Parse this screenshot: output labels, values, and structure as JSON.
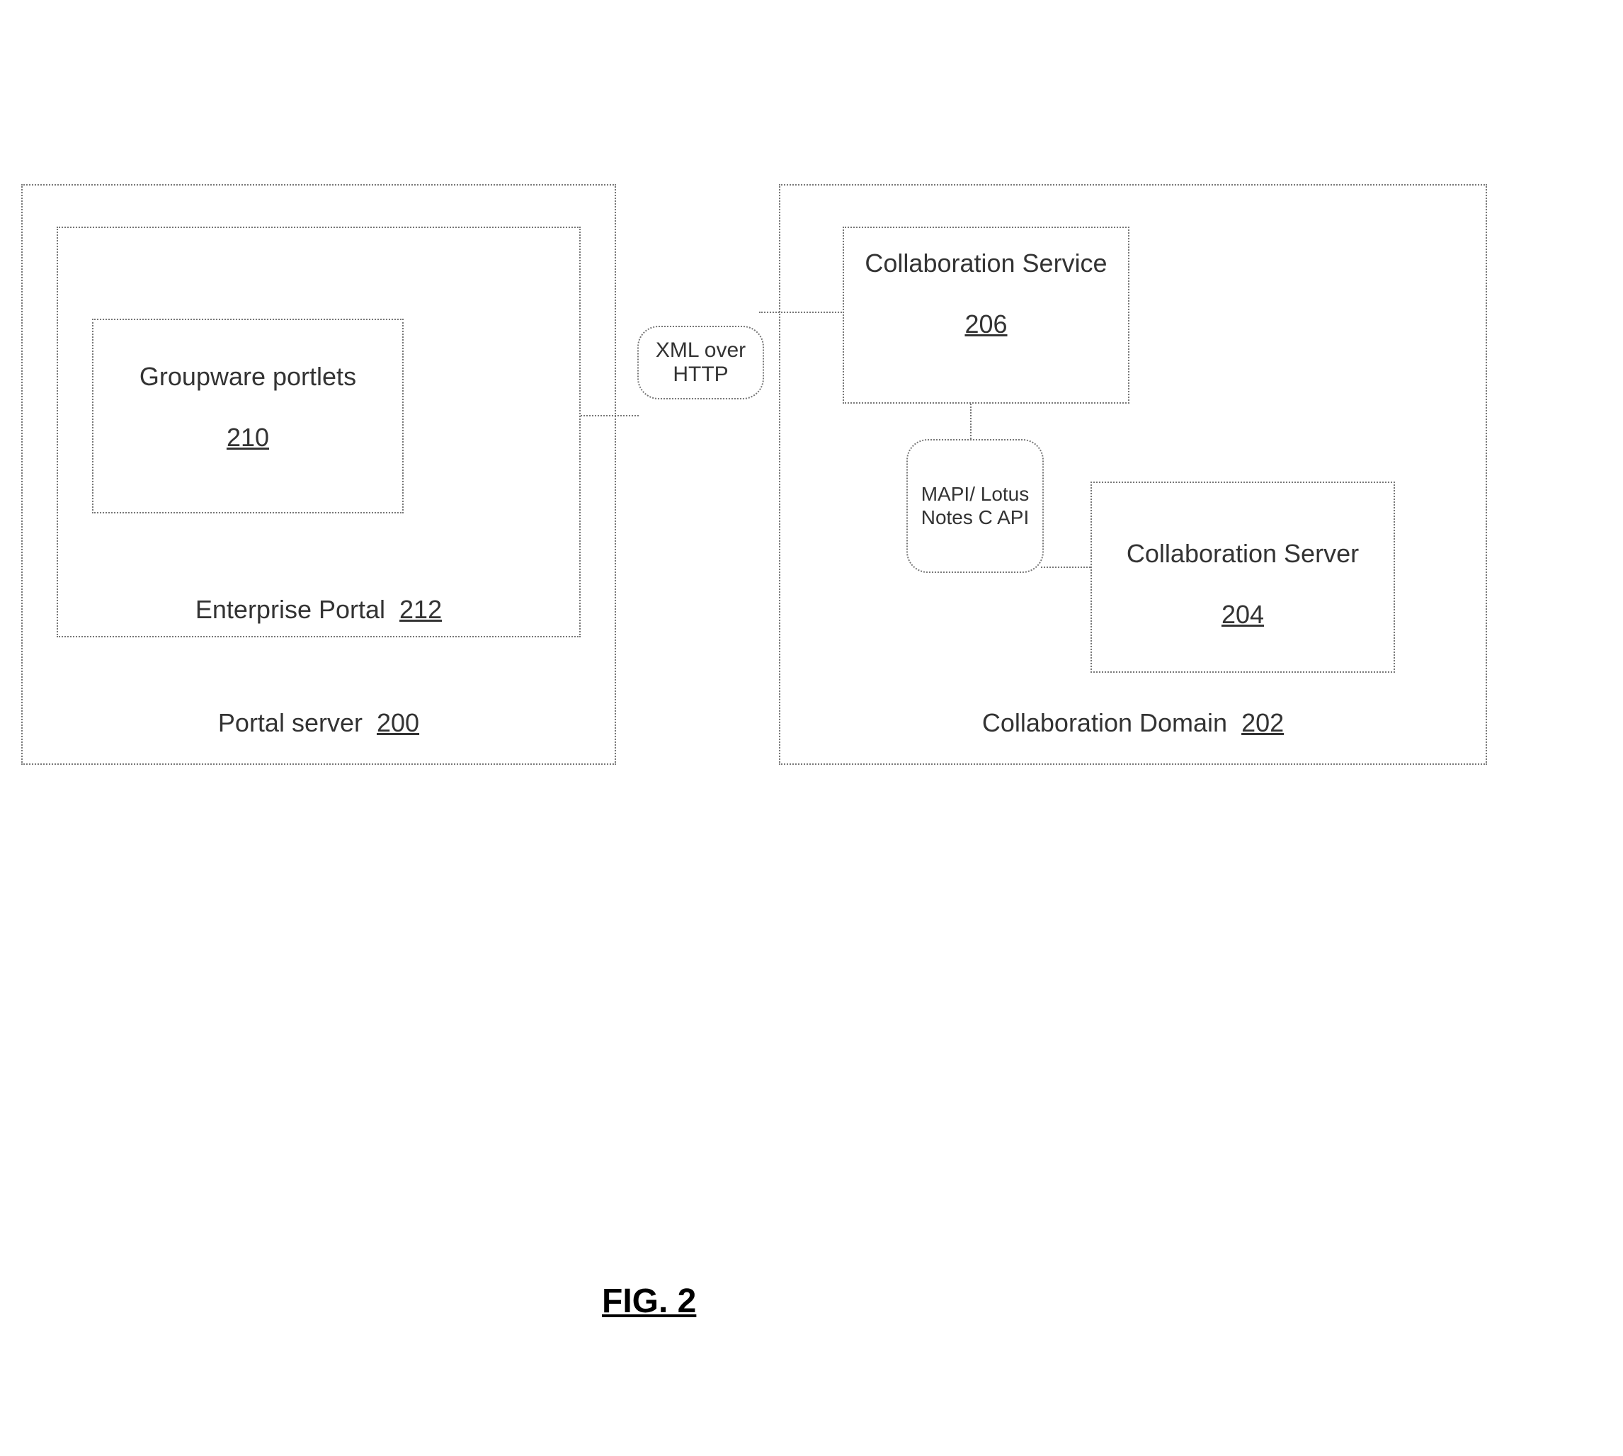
{
  "figure_caption": "FIG. 2",
  "left": {
    "outer": {
      "label": "Portal server",
      "ref": "200"
    },
    "mid": {
      "label": "Enterprise Portal",
      "ref": "212"
    },
    "inner": {
      "label": "Groupware portlets",
      "ref": "210"
    }
  },
  "right": {
    "outer": {
      "label": "Collaboration Domain",
      "ref": "202"
    },
    "service": {
      "label": "Collaboration Service",
      "ref": "206"
    },
    "server": {
      "label": "Collaboration Server",
      "ref": "204"
    }
  },
  "links": {
    "a": "XML over HTTP",
    "b": "MAPI/ Lotus Notes C API"
  }
}
